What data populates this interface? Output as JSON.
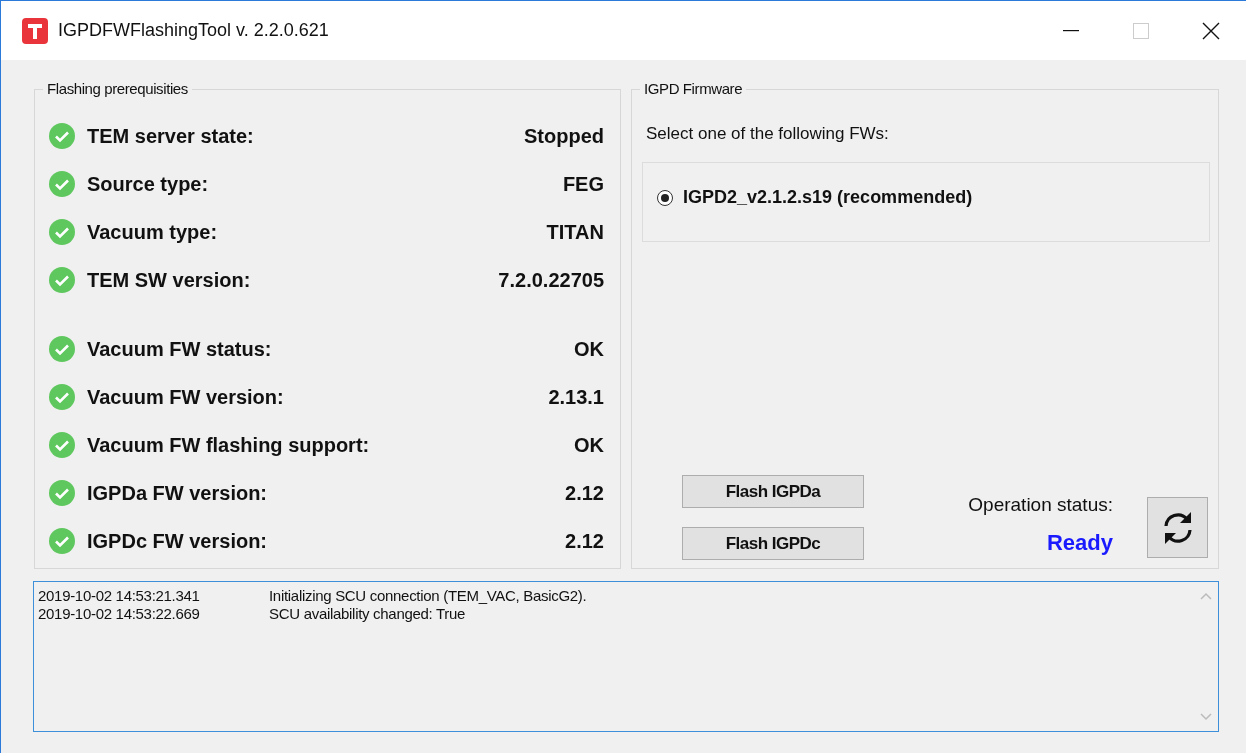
{
  "window": {
    "title": "IGPDFWFlashingTool v. 2.2.0.621"
  },
  "prerequisites": {
    "title": "Flashing prerequisities",
    "sections": [
      {
        "rows": [
          {
            "label": "TEM server state:",
            "value": "Stopped",
            "ok": true
          },
          {
            "label": "Source type:",
            "value": "FEG",
            "ok": true
          },
          {
            "label": "Vacuum type:",
            "value": "TITAN",
            "ok": true
          },
          {
            "label": "TEM SW version:",
            "value": "7.2.0.22705",
            "ok": true
          }
        ]
      },
      {
        "rows": [
          {
            "label": "Vacuum FW status:",
            "value": "OK",
            "ok": true
          },
          {
            "label": "Vacuum FW version:",
            "value": "2.13.1",
            "ok": true
          },
          {
            "label": "Vacuum FW flashing support:",
            "value": "OK",
            "ok": true
          },
          {
            "label": "IGPDa FW version:",
            "value": "2.12",
            "ok": true
          },
          {
            "label": "IGPDc FW version:",
            "value": "2.12",
            "ok": true
          }
        ]
      }
    ]
  },
  "firmware": {
    "title": "IGPD Firmware",
    "prompt": "Select one of the following FWs:",
    "options": [
      {
        "label": "IGPD2_v2.1.2.s19 (recommended)",
        "selected": true
      }
    ],
    "buttons": [
      "Flash IGPDa",
      "Flash IGPDc"
    ],
    "status_label": "Operation status:",
    "status_value": "Ready"
  },
  "log": [
    {
      "time": "2019-10-02 14:53:21.341",
      "message": "Initializing SCU connection (TEM_VAC, BasicG2)."
    },
    {
      "time": "2019-10-02 14:53:22.669",
      "message": "SCU availability changed: True"
    }
  ]
}
